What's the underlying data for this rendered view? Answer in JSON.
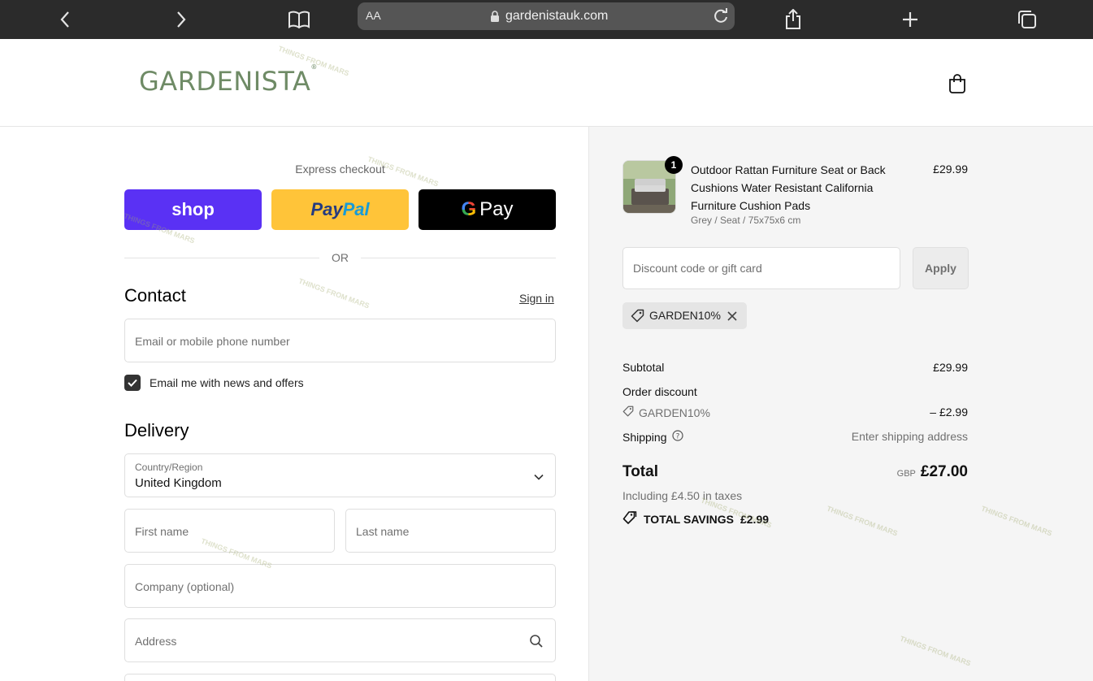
{
  "browser": {
    "address_aa": "AA",
    "url": "gardenistauk.com"
  },
  "header": {
    "logo": "GARDENISTA",
    "logo_mark": "®"
  },
  "express": {
    "title": "Express checkout",
    "shop_label": "shop",
    "paypal_label_1": "Pay",
    "paypal_label_2": "Pal",
    "gpay_g": "G",
    "gpay_label": "Pay",
    "or_label": "OR"
  },
  "contact": {
    "title": "Contact",
    "signin": "Sign in",
    "email_placeholder": "Email or mobile phone number",
    "news_label": "Email me with news and offers",
    "news_checked": true
  },
  "delivery": {
    "title": "Delivery",
    "country_label": "Country/Region",
    "country_value": "United Kingdom",
    "first_name": "First name",
    "last_name": "Last name",
    "company": "Company (optional)",
    "address": "Address"
  },
  "order": {
    "item": {
      "qty": "1",
      "name": "Outdoor Rattan Furniture Seat or Back Cushions Water Resistant California Furniture Cushion Pads",
      "variant": "Grey / Seat / 75x75x6 cm",
      "price": "£29.99"
    },
    "discount_placeholder": "Discount code or gift card",
    "apply_label": "Apply",
    "applied_code": "GARDEN10%",
    "subtotal_label": "Subtotal",
    "subtotal_value": "£29.99",
    "order_discount_label": "Order discount",
    "discount_code": "GARDEN10%",
    "discount_value": "– £2.99",
    "shipping_label": "Shipping",
    "shipping_value": "Enter shipping address",
    "total_label": "Total",
    "currency": "GBP",
    "total_value": "£27.00",
    "taxes": "Including £4.50 in taxes",
    "savings_label": "TOTAL SAVINGS",
    "savings_value": "£2.99"
  },
  "colors": {
    "shop": "#5a31f4",
    "paypal": "#ffc439",
    "gpay": "#000000",
    "logo": "#6f8b66"
  }
}
